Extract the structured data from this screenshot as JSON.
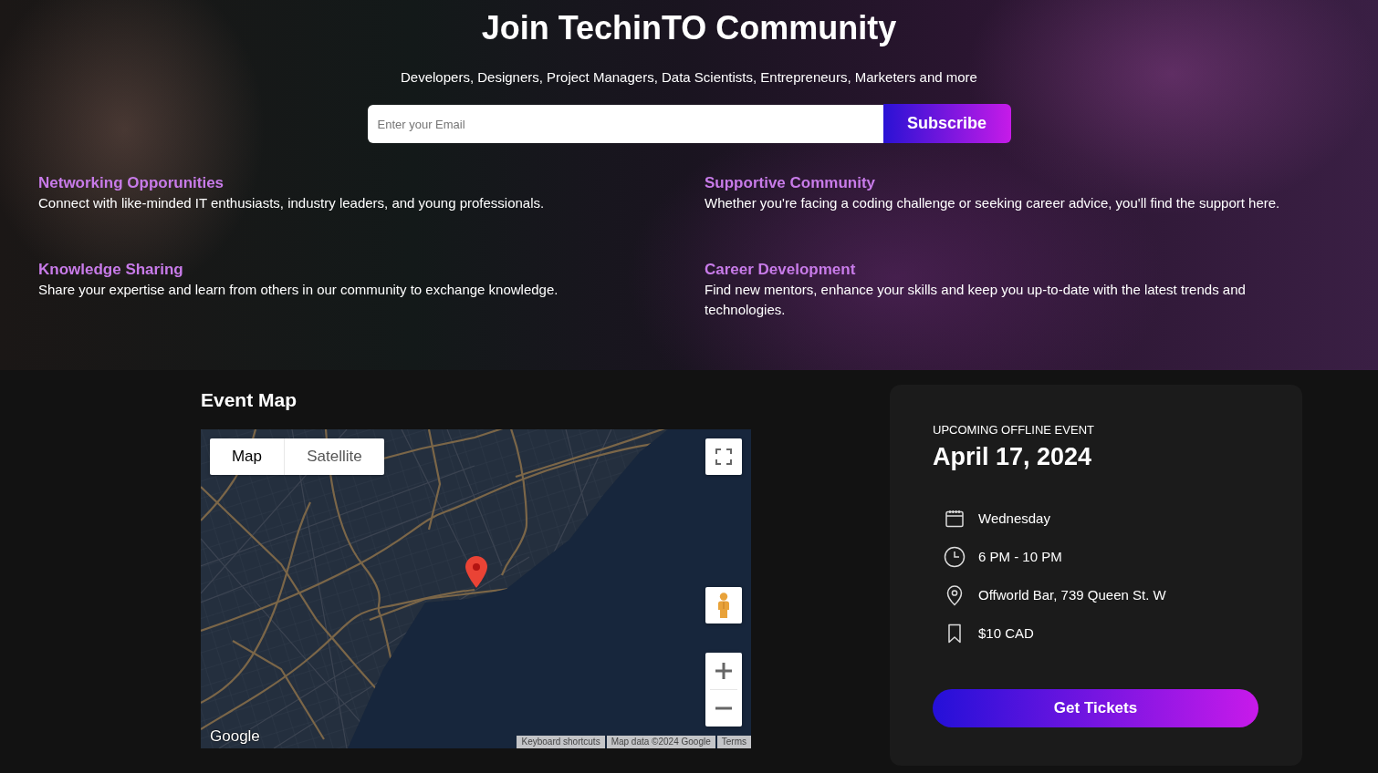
{
  "hero": {
    "title": "Join TechinTO Community",
    "subtitle": "Developers, Designers, Project Managers, Data Scientists, Entrepreneurs, Marketers and more",
    "email_field": {
      "placeholder": "Enter your Email"
    },
    "subscribe_button": "Subscribe"
  },
  "features": [
    {
      "title": "Networking Opporunities",
      "text": "Connect with like-minded IT enthusiasts, industry leaders, and young professionals."
    },
    {
      "title": "Supportive Community",
      "text": "Whether you're facing a coding challenge or seeking career advice, you'll find the support here."
    },
    {
      "title": "Knowledge Sharing",
      "text": "Share your expertise and learn from others in our community to exchange knowledge."
    },
    {
      "title": "Career Development",
      "text": "Find new mentors, enhance your skills and keep you up-to-date with the latest trends and technologies."
    }
  ],
  "event_map": {
    "title": "Event Map",
    "map_types": [
      {
        "label": "Map",
        "selected": true
      },
      {
        "label": "Satellite",
        "selected": false
      }
    ],
    "logo": "Google",
    "attribution": [
      "Keyboard shortcuts",
      "Map data ©2024 Google",
      "Terms"
    ]
  },
  "event_card": {
    "label": "UPCOMING OFFLINE EVENT",
    "date": "April 17, 2024",
    "details": [
      {
        "kind": "day",
        "text": "Wednesday"
      },
      {
        "kind": "time",
        "text": "6 PM - 10 PM"
      },
      {
        "kind": "location",
        "text": "Offworld Bar, 739 Queen St. W"
      },
      {
        "kind": "price",
        "text": "$10 CAD"
      }
    ],
    "button": "Get Tickets"
  }
}
